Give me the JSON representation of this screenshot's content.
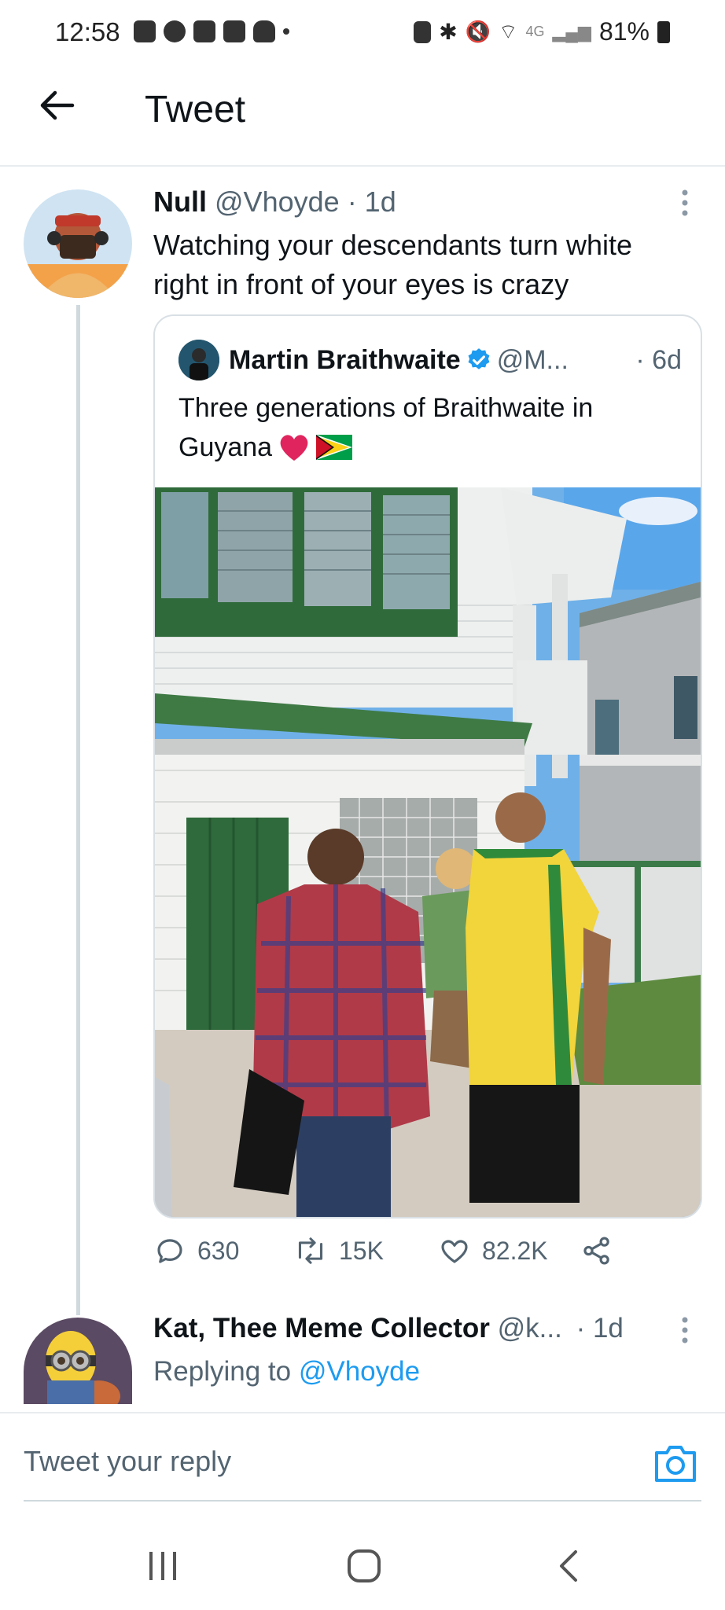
{
  "status_bar": {
    "time": "12:58",
    "network": "4G",
    "battery": "81%"
  },
  "header": {
    "title": "Tweet"
  },
  "tweet": {
    "author_name": "Null",
    "handle": "@Vhoyde",
    "time": "· 1d",
    "text_line1": "Watching your descendants turn white",
    "text_line2": "right in front of your eyes is crazy"
  },
  "quote": {
    "author_name": "Martin Braithwaite",
    "handle": "@M...",
    "time": "· 6d",
    "text_line1": "Three generations of Braithwaite in",
    "text_line2": "Guyana"
  },
  "actions": {
    "replies": "630",
    "retweets": "15K",
    "likes": "82.2K"
  },
  "reply": {
    "author_name": "Kat, Thee Meme Collector",
    "handle": "@k...",
    "time": "· 1d",
    "replying_label": "Replying to",
    "replying_handle": "@Vhoyde"
  },
  "composer": {
    "placeholder": "Tweet your reply"
  },
  "colors": {
    "accent": "#1d9bf0",
    "muted": "#536471",
    "like_red": "#e0245e"
  }
}
